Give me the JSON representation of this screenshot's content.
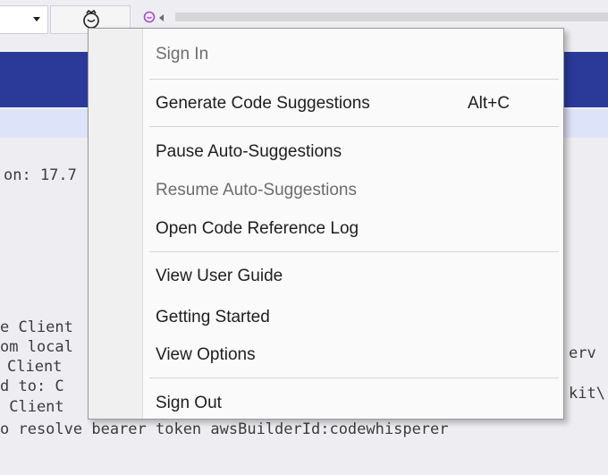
{
  "menu": {
    "items": [
      {
        "label": "Sign In",
        "disabled": true
      },
      {
        "label": "Generate Code Suggestions",
        "shortcut": "Alt+C"
      },
      {
        "label": "Pause Auto-Suggestions"
      },
      {
        "label": "Resume Auto-Suggestions",
        "disabled": true
      },
      {
        "label": "Open Code Reference Log"
      },
      {
        "label": "View User Guide"
      },
      {
        "label": "Getting Started"
      },
      {
        "label": "View Options"
      },
      {
        "label": "Sign Out"
      }
    ]
  },
  "output": {
    "lines": [
      "on: 17.7",
      "e Client",
      "om local",
      "Client",
      "d to: C",
      " Client",
      "o resolve bearer token awsBuilderId:codewhisperer",
      "erv",
      "kit\\"
    ]
  },
  "icons": {
    "toolbar_dropdown": "chevron-down-icon",
    "toolbar_button": "aws-toolkit-icon",
    "toolbar_second": "purple-circle-icon"
  },
  "colors": {
    "title_bar": "#2b3a99",
    "input_bar": "#dde3f8",
    "menu_bg": "#fafafa"
  }
}
